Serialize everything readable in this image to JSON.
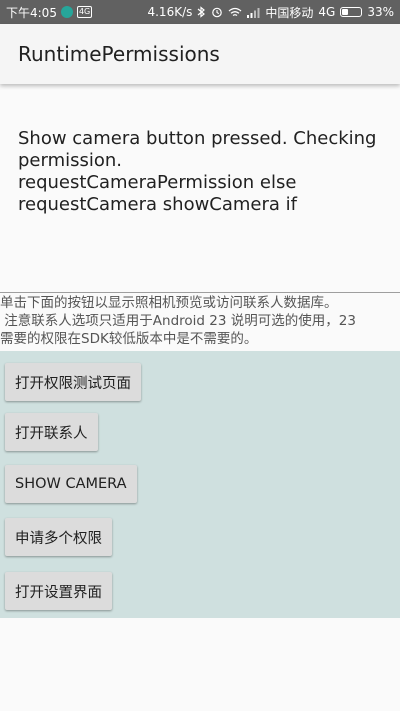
{
  "status_bar": {
    "time": "下午4:05",
    "network_speed": "4.16K/s",
    "carrier": "中国移动",
    "network_type": "4G",
    "battery_percent": "33%",
    "battery_level": 0.33,
    "icons": [
      "shield-icon",
      "hd-badge",
      "bluetooth-icon",
      "alarm-icon",
      "wifi-icon",
      "signal-icon",
      "battery-icon"
    ],
    "color": "#616161"
  },
  "app_bar": {
    "title": "RuntimePermissions",
    "background": "#f5f5f5"
  },
  "log": {
    "lines": [
      "Show camera button pressed. Checking",
      "permission.",
      "requestCameraPermission else",
      "requestCamera showCamera if"
    ]
  },
  "description": {
    "lines": [
      "单击下面的按钮以显示照相机预览或访问联系人数据库。",
      " 注意联系人选项只适用于Android 23 说明可选的使用，23",
      "需要的权限在SDK较低版本中是不需要的。"
    ]
  },
  "buttons": {
    "panel_color": "#cfe0df",
    "open_permission_test": "打开权限测试页面",
    "open_contacts": "打开联系人",
    "show_camera": "SHOW CAMERA",
    "request_multiple": "申请多个权限",
    "open_settings": "打开设置界面"
  }
}
